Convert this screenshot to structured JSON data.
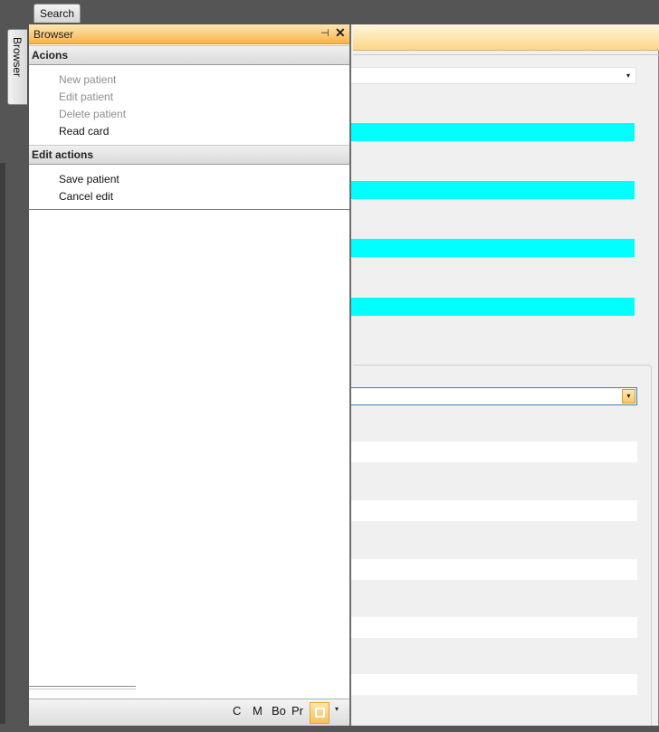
{
  "top_tabs": {
    "search": "Search"
  },
  "side_rail": {
    "browser_tab": "Browser"
  },
  "browser_panel": {
    "title": "Browser",
    "pin_glyph": "⊣",
    "close_glyph": "✕",
    "groups": [
      {
        "header": "Acions",
        "items": [
          {
            "label": "New patient",
            "enabled": false
          },
          {
            "label": "Edit patient",
            "enabled": false
          },
          {
            "label": "Delete patient",
            "enabled": false
          },
          {
            "label": "Read card",
            "enabled": true
          }
        ]
      },
      {
        "header": "Edit actions",
        "items": [
          {
            "label": "Save patient",
            "enabled": true
          },
          {
            "label": "Cancel edit",
            "enabled": true
          }
        ]
      }
    ],
    "bottom_toolbar": [
      "C",
      "M",
      "Bo",
      "Pr"
    ],
    "more_glyph": "▾"
  },
  "form": {
    "combo_arrow": "▾",
    "colors": {
      "required_field": "#00ffff",
      "header_accent": "#f8b34a"
    }
  }
}
